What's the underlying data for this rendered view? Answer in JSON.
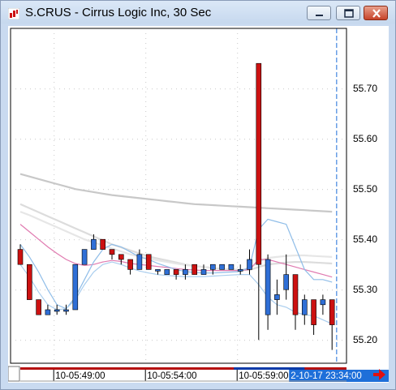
{
  "window": {
    "title": "S.CRUS - Cirrus Logic Inc, 30 Sec"
  },
  "icons": {
    "app": "chart-app-icon",
    "minimize": "minimize-icon",
    "maximize": "maximize-icon",
    "close": "close-icon",
    "scroll_right": "arrow-right-icon"
  },
  "colors": {
    "up_candle": "#2f6fd6",
    "down_candle": "#cc1111",
    "accent_blue": "#1e6fd9",
    "arrow_red": "#e01010"
  },
  "chart_data": {
    "type": "candlestick",
    "symbol": "S.CRUS",
    "interval": "30 Sec",
    "y_ticks": [
      "55.70",
      "55.60",
      "55.50",
      "55.40",
      "55.30",
      "55.20"
    ],
    "y_tick_values": [
      55.7,
      55.6,
      55.5,
      55.4,
      55.3,
      55.2
    ],
    "ylim": [
      55.16,
      55.81
    ],
    "x_labels": [
      "10-05:49:00",
      "10-05:54:00",
      "10-05:59:00"
    ],
    "x_label_indices": [
      4,
      14,
      24
    ],
    "crosshair_label": "2-10-17 23:34:00",
    "crosshair_index": 34.5,
    "candles": [
      {
        "o": 55.38,
        "h": 55.39,
        "l": 55.35,
        "c": 55.35
      },
      {
        "o": 55.35,
        "h": 55.35,
        "l": 55.28,
        "c": 55.28
      },
      {
        "o": 55.28,
        "h": 55.28,
        "l": 55.25,
        "c": 55.25
      },
      {
        "o": 55.25,
        "h": 55.27,
        "l": 55.25,
        "c": 55.26
      },
      {
        "o": 55.26,
        "h": 55.27,
        "l": 55.25,
        "c": 55.26
      },
      {
        "o": 55.26,
        "h": 55.27,
        "l": 55.25,
        "c": 55.26
      },
      {
        "o": 55.26,
        "h": 55.35,
        "l": 55.26,
        "c": 55.35
      },
      {
        "o": 55.35,
        "h": 55.38,
        "l": 55.35,
        "c": 55.38
      },
      {
        "o": 55.38,
        "h": 55.41,
        "l": 55.38,
        "c": 55.4
      },
      {
        "o": 55.4,
        "h": 55.4,
        "l": 55.38,
        "c": 55.38
      },
      {
        "o": 55.38,
        "h": 55.38,
        "l": 55.36,
        "c": 55.37
      },
      {
        "o": 55.37,
        "h": 55.37,
        "l": 55.35,
        "c": 55.36
      },
      {
        "o": 55.36,
        "h": 55.36,
        "l": 55.33,
        "c": 55.34
      },
      {
        "o": 55.34,
        "h": 55.38,
        "l": 55.34,
        "c": 55.37
      },
      {
        "o": 55.37,
        "h": 55.37,
        "l": 55.34,
        "c": 55.34
      },
      {
        "o": 55.34,
        "h": 55.34,
        "l": 55.33,
        "c": 55.34
      },
      {
        "o": 55.33,
        "h": 55.34,
        "l": 55.33,
        "c": 55.34
      },
      {
        "o": 55.34,
        "h": 55.34,
        "l": 55.32,
        "c": 55.33
      },
      {
        "o": 55.33,
        "h": 55.35,
        "l": 55.32,
        "c": 55.34
      },
      {
        "o": 55.35,
        "h": 55.35,
        "l": 55.33,
        "c": 55.33
      },
      {
        "o": 55.33,
        "h": 55.35,
        "l": 55.33,
        "c": 55.34
      },
      {
        "o": 55.34,
        "h": 55.35,
        "l": 55.33,
        "c": 55.35
      },
      {
        "o": 55.34,
        "h": 55.35,
        "l": 55.34,
        "c": 55.35
      },
      {
        "o": 55.34,
        "h": 55.35,
        "l": 55.34,
        "c": 55.35
      },
      {
        "o": 55.34,
        "h": 55.35,
        "l": 55.33,
        "c": 55.34
      },
      {
        "o": 55.34,
        "h": 55.38,
        "l": 55.33,
        "c": 55.36
      },
      {
        "o": 55.75,
        "h": 55.75,
        "l": 55.2,
        "c": 55.35
      },
      {
        "o": 55.25,
        "h": 55.37,
        "l": 55.22,
        "c": 55.36
      },
      {
        "o": 55.28,
        "h": 55.32,
        "l": 55.25,
        "c": 55.29
      },
      {
        "o": 55.3,
        "h": 55.37,
        "l": 55.28,
        "c": 55.33
      },
      {
        "o": 55.33,
        "h": 55.33,
        "l": 55.22,
        "c": 55.25
      },
      {
        "o": 55.25,
        "h": 55.29,
        "l": 55.23,
        "c": 55.28
      },
      {
        "o": 55.28,
        "h": 55.28,
        "l": 55.21,
        "c": 55.23
      },
      {
        "o": 55.27,
        "h": 55.29,
        "l": 55.25,
        "c": 55.28
      },
      {
        "o": 55.28,
        "h": 55.28,
        "l": 55.18,
        "c": 55.23
      }
    ],
    "overlays": [
      {
        "color": "#c8c8c8",
        "values": [
          55.53,
          55.525,
          55.52,
          55.515,
          55.51,
          55.505,
          55.5,
          55.497,
          55.494,
          55.491,
          55.488,
          55.486,
          55.484,
          55.482,
          55.48,
          55.478,
          55.476,
          55.474,
          55.472,
          55.47,
          55.469,
          55.468,
          55.467,
          55.466,
          55.465,
          55.464,
          55.463,
          55.462,
          55.461,
          55.46,
          55.459,
          55.458,
          55.457,
          55.456,
          55.455
        ]
      },
      {
        "color": "#dcdcdc",
        "values": [
          55.47,
          55.462,
          55.454,
          55.446,
          55.438,
          55.43,
          55.422,
          55.414,
          55.406,
          55.398,
          55.39,
          55.384,
          55.378,
          55.372,
          55.366,
          55.362,
          55.358,
          55.354,
          55.35,
          55.347,
          55.345,
          55.343,
          55.341,
          55.34,
          55.339,
          55.339,
          55.345,
          55.35,
          55.352,
          55.354,
          55.355,
          55.355,
          55.354,
          55.353,
          55.352
        ]
      },
      {
        "color": "#e6e6e6",
        "values": [
          55.455,
          55.448,
          55.44,
          55.432,
          55.424,
          55.416,
          55.408,
          55.4,
          55.394,
          55.388,
          55.382,
          55.376,
          55.37,
          55.366,
          55.362,
          55.358,
          55.355,
          55.352,
          55.349,
          55.347,
          55.345,
          55.343,
          55.341,
          55.34,
          55.34,
          55.341,
          55.356,
          55.363,
          55.365,
          55.367,
          55.368,
          55.368,
          55.367,
          55.366,
          55.365
        ]
      },
      {
        "color": "#e07ab0",
        "values": [
          55.43,
          55.415,
          55.4,
          55.385,
          55.372,
          55.36,
          55.352,
          55.348,
          55.35,
          55.355,
          55.358,
          55.356,
          55.352,
          55.35,
          55.348,
          55.346,
          55.344,
          55.342,
          55.34,
          55.339,
          55.338,
          55.338,
          55.338,
          55.338,
          55.338,
          55.34,
          55.36,
          55.36,
          55.355,
          55.35,
          55.345,
          55.34,
          55.335,
          55.33,
          55.325
        ]
      },
      {
        "color": "#8fbde8",
        "values": [
          55.39,
          55.365,
          55.335,
          55.3,
          55.27,
          55.262,
          55.285,
          55.32,
          55.355,
          55.38,
          55.39,
          55.385,
          55.375,
          55.365,
          55.36,
          55.352,
          55.346,
          55.34,
          55.336,
          55.334,
          55.333,
          55.333,
          55.334,
          55.335,
          55.336,
          55.345,
          55.42,
          55.44,
          55.435,
          55.43,
          55.385,
          55.34,
          55.32,
          55.32,
          55.315
        ]
      },
      {
        "color": "#a9cdee",
        "values": [
          55.35,
          55.325,
          55.295,
          55.27,
          55.26,
          55.262,
          55.28,
          55.31,
          55.335,
          55.35,
          55.355,
          55.35,
          55.343,
          55.337,
          55.333,
          55.33,
          55.328,
          55.327,
          55.326,
          55.326,
          55.326,
          55.327,
          55.328,
          55.329,
          55.33,
          55.33,
          55.31,
          55.285,
          55.27,
          55.265,
          55.255,
          55.25,
          55.248,
          55.24,
          55.232
        ]
      }
    ]
  }
}
